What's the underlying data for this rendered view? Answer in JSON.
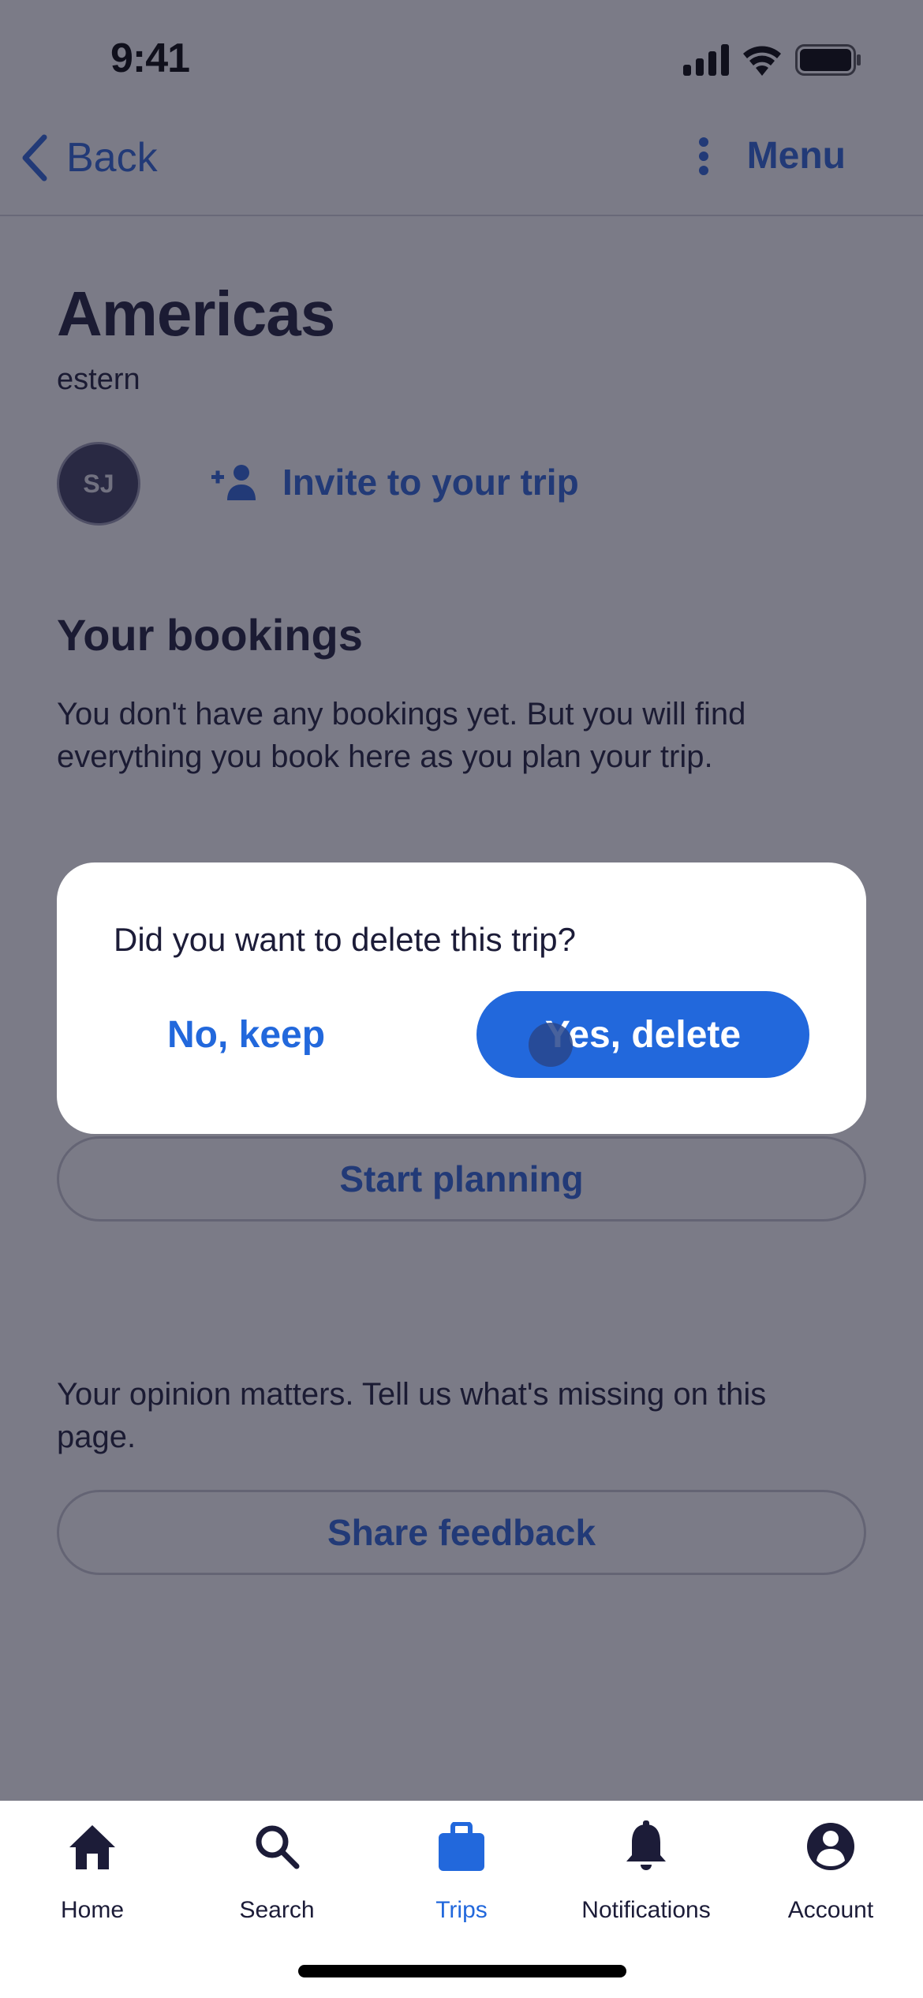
{
  "status_bar": {
    "time": "9:41"
  },
  "nav": {
    "back_label": "Back",
    "menu_label": "Menu"
  },
  "trip": {
    "title": "Americas",
    "subtitle": "estern",
    "avatar_initials": "SJ",
    "invite_label": "Invite to your trip"
  },
  "bookings": {
    "title": "Your bookings",
    "empty_text": "You don't have any bookings yet. But you will find everything you book here as you plan your trip.",
    "start_planning_label": "Start planning"
  },
  "feedback": {
    "text": "Your opinion matters. Tell us what's missing on this page.",
    "button_label": "Share feedback"
  },
  "dialog": {
    "question": "Did you want to delete this trip?",
    "cancel_label": "No, keep",
    "confirm_label": "Yes, delete"
  },
  "tabbar": {
    "items": [
      {
        "label": "Home",
        "icon": "home-icon",
        "active": false
      },
      {
        "label": "Search",
        "icon": "search-icon",
        "active": false
      },
      {
        "label": "Trips",
        "icon": "briefcase-icon",
        "active": true
      },
      {
        "label": "Notifications",
        "icon": "bell-icon",
        "active": false
      },
      {
        "label": "Account",
        "icon": "account-icon",
        "active": false
      }
    ]
  },
  "colors": {
    "accent": "#2268dc",
    "text": "#1c1c38",
    "scrim": "#7a7887"
  }
}
